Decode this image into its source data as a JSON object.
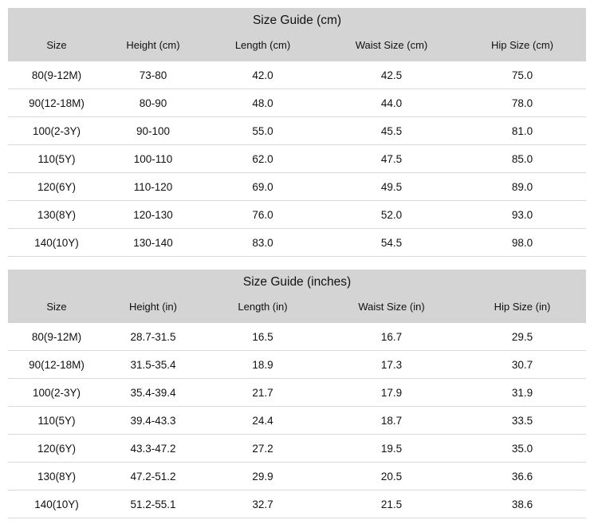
{
  "cm_table": {
    "title": "Size Guide (cm)",
    "headers": [
      "Size",
      "Height (cm)",
      "Length (cm)",
      "Waist Size (cm)",
      "Hip Size (cm)"
    ],
    "rows": [
      [
        "80(9-12M)",
        "73-80",
        "42.0",
        "42.5",
        "75.0"
      ],
      [
        "90(12-18M)",
        "80-90",
        "48.0",
        "44.0",
        "78.0"
      ],
      [
        "100(2-3Y)",
        "90-100",
        "55.0",
        "45.5",
        "81.0"
      ],
      [
        "110(5Y)",
        "100-110",
        "62.0",
        "47.5",
        "85.0"
      ],
      [
        "120(6Y)",
        "110-120",
        "69.0",
        "49.5",
        "89.0"
      ],
      [
        "130(8Y)",
        "120-130",
        "76.0",
        "52.0",
        "93.0"
      ],
      [
        "140(10Y)",
        "130-140",
        "83.0",
        "54.5",
        "98.0"
      ]
    ]
  },
  "in_table": {
    "title": "Size Guide (inches)",
    "headers": [
      "Size",
      "Height (in)",
      "Length (in)",
      "Waist Size (in)",
      "Hip Size (in)"
    ],
    "rows": [
      [
        "80(9-12M)",
        "28.7-31.5",
        "16.5",
        "16.7",
        "29.5"
      ],
      [
        "90(12-18M)",
        "31.5-35.4",
        "18.9",
        "17.3",
        "30.7"
      ],
      [
        "100(2-3Y)",
        "35.4-39.4",
        "21.7",
        "17.9",
        "31.9"
      ],
      [
        "110(5Y)",
        "39.4-43.3",
        "24.4",
        "18.7",
        "33.5"
      ],
      [
        "120(6Y)",
        "43.3-47.2",
        "27.2",
        "19.5",
        "35.0"
      ],
      [
        "130(8Y)",
        "47.2-51.2",
        "29.9",
        "20.5",
        "36.6"
      ],
      [
        "140(10Y)",
        "51.2-55.1",
        "32.7",
        "21.5",
        "38.6"
      ]
    ]
  }
}
